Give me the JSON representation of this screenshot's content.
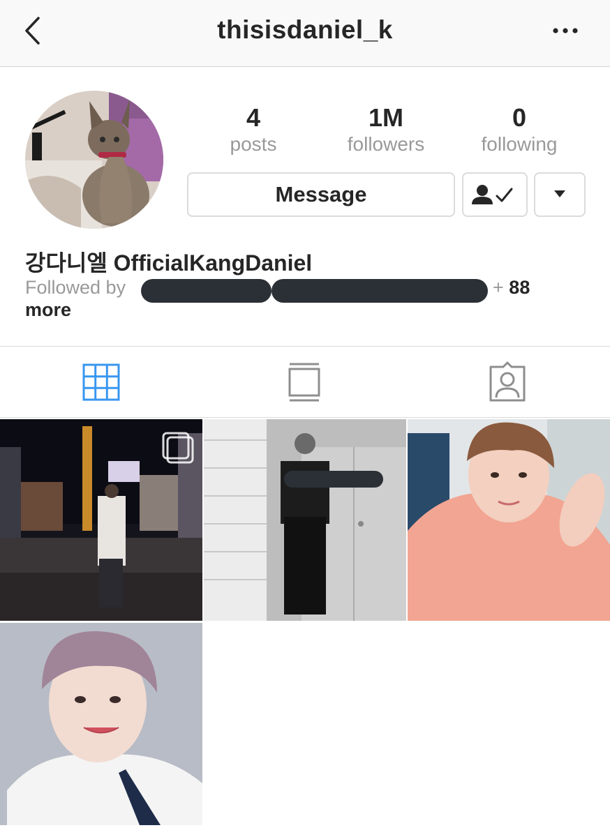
{
  "nav": {
    "title": "thisisdaniel_k",
    "back_icon": "chevron-left-icon",
    "more_icon": "more-horizontal-icon"
  },
  "profile": {
    "stats": [
      {
        "value": "4",
        "label": "posts"
      },
      {
        "value": "1M",
        "label": "followers"
      },
      {
        "value": "0",
        "label": "following"
      }
    ],
    "message_label": "Message",
    "following_icon": "person-check-icon",
    "dropdown_icon": "caret-down-icon",
    "display_name": "강다니엘 OfficialKangDaniel",
    "followed_by_label": "Followed by",
    "followed_by_more_plus": "+",
    "followed_by_more_count": "88",
    "followed_by_more_word": "more"
  },
  "tabs": [
    {
      "name": "grid-view",
      "icon": "grid-icon",
      "active": true
    },
    {
      "name": "feed-view",
      "icon": "feed-icon",
      "active": false
    },
    {
      "name": "tagged",
      "icon": "tagged-person-icon",
      "active": false
    }
  ],
  "colors": {
    "active_tab": "#3897f0",
    "inactive_icon": "#8e8e8e",
    "text_primary": "#262626",
    "text_secondary": "#999999",
    "border": "#dbdbdb",
    "redaction": "#2b3036"
  },
  "posts": [
    {
      "description": "night street photo",
      "multi_image": true
    },
    {
      "description": "black and white photo",
      "multi_image": false
    },
    {
      "description": "selfie in pink hoodie",
      "multi_image": false
    },
    {
      "description": "portrait in white shirt",
      "multi_image": false
    }
  ]
}
